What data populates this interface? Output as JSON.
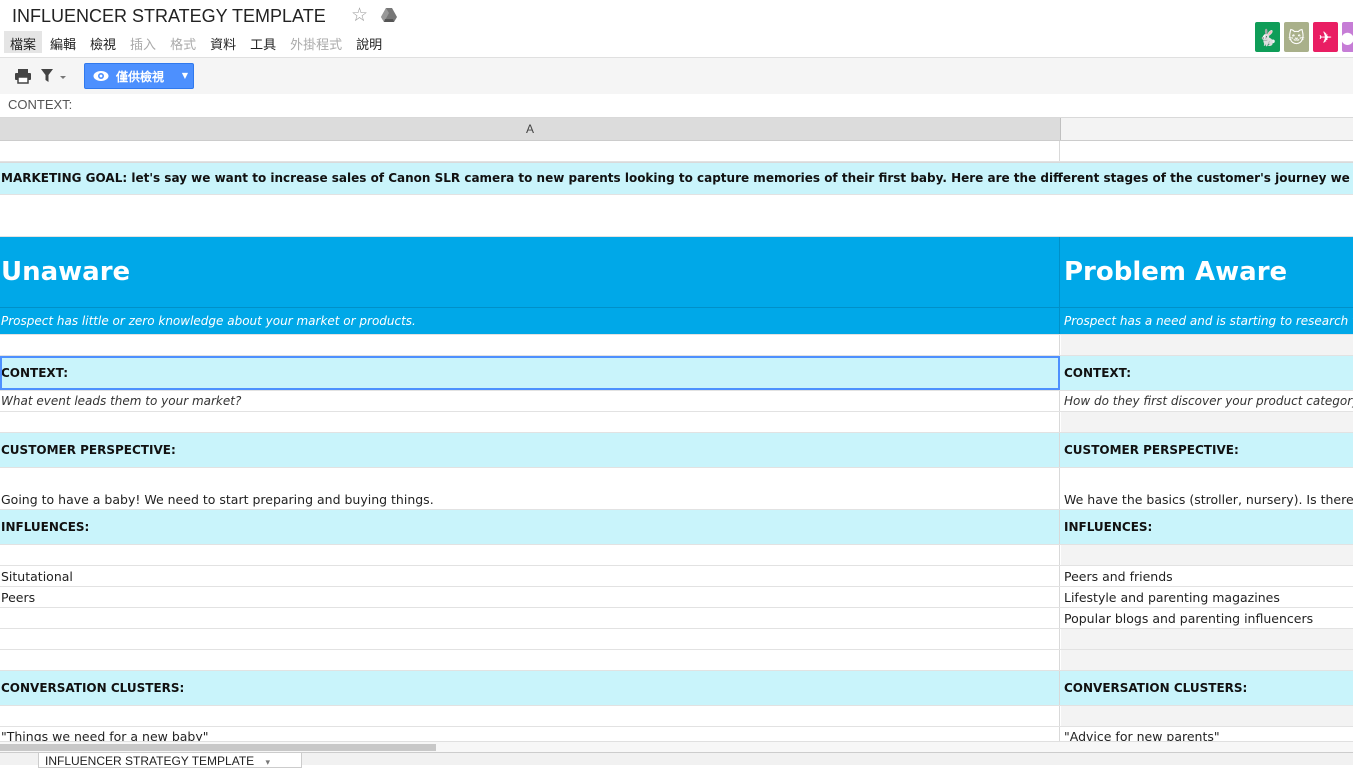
{
  "app": {
    "title": "INFLUENCER STRATEGY TEMPLATE",
    "star": "☆",
    "menu": [
      {
        "label": "檔案",
        "active": true,
        "disabled": false
      },
      {
        "label": "編輯",
        "active": false,
        "disabled": false
      },
      {
        "label": "檢視",
        "active": false,
        "disabled": false
      },
      {
        "label": "插入",
        "active": false,
        "disabled": true
      },
      {
        "label": "格式",
        "active": false,
        "disabled": true
      },
      {
        "label": "資料",
        "active": false,
        "disabled": false
      },
      {
        "label": "工具",
        "active": false,
        "disabled": false
      },
      {
        "label": "外掛程式",
        "active": false,
        "disabled": true
      },
      {
        "label": "說明",
        "active": false,
        "disabled": false
      }
    ],
    "app_icons": [
      {
        "name": "rabbit-app-icon",
        "color": "#0f9d58"
      },
      {
        "name": "cat-app-icon",
        "color": "#a9b08a"
      },
      {
        "name": "plane-app-icon",
        "color": "#e91e63"
      },
      {
        "name": "partial-app-icon",
        "color": "#c67dd6"
      }
    ]
  },
  "toolbar": {
    "view_button_label": "僅供檢視"
  },
  "formula_bar": {
    "value": "CONTEXT:"
  },
  "columns": {
    "a": "A",
    "b": ""
  },
  "sheet": {
    "marketing_goal": "MARKETING GOAL: let's say we want to increase sales of Canon SLR camera to new parents looking to capture memories of their first baby. Here are the different stages of the customer's journey we can partner with influencers",
    "stages": [
      {
        "title": "Unaware",
        "description": "Prospect has little or zero knowledge about your market or products.",
        "context_label": "CONTEXT:",
        "context_question": "What event leads them to your market?",
        "perspective_label": "CUSTOMER PERSPECTIVE:",
        "perspective_text": "Going to have a baby! We need to start preparing and buying things.",
        "influences_label": "INFLUENCES:",
        "influences": [
          "Situtational",
          "Peers",
          ""
        ],
        "clusters_label": "CONVERSATION CLUSTERS:",
        "cluster_text": "\"Things we need for a new baby\""
      },
      {
        "title": "Problem Aware",
        "description": "Prospect has a need and is starting to research their options.",
        "context_label": "CONTEXT:",
        "context_question": "How do they first discover your product category?",
        "perspective_label": "CUSTOMER PERSPECTIVE:",
        "perspective_text": "We have the basics (stroller, nursery). Is there anything else we need?",
        "influences_label": "INFLUENCES:",
        "influences": [
          "Peers and friends",
          "Lifestyle and parenting magazines",
          "Popular blogs and parenting influencers"
        ],
        "clusters_label": "CONVERSATION CLUSTERS:",
        "cluster_text": "\"Advice for new parents\""
      }
    ]
  },
  "sheet_tab": {
    "label": "INFLUENCER STRATEGY TEMPLATE",
    "caret": "▾"
  }
}
